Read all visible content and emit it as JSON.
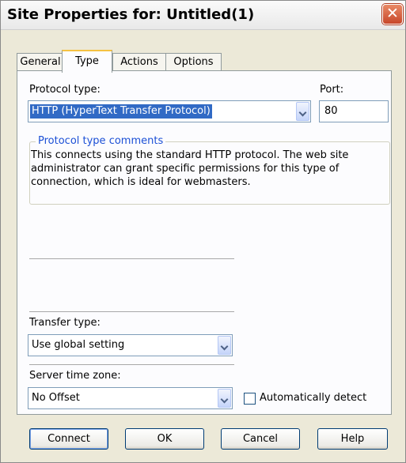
{
  "window": {
    "title": "Site Properties for: Untitled(1)",
    "close_glyph": "✕"
  },
  "tabs": [
    {
      "label": "General",
      "active": false
    },
    {
      "label": "Type",
      "active": true
    },
    {
      "label": "Actions",
      "active": false
    },
    {
      "label": "Options",
      "active": false
    }
  ],
  "protocol": {
    "label": "Protocol type:",
    "value": "HTTP (HyperText Transfer Protocol)"
  },
  "port": {
    "label": "Port:",
    "value": "80"
  },
  "comments": {
    "legend": "Protocol type comments",
    "text": "This connects using the standard HTTP protocol. The web site administrator can grant specific permissions for this type of connection, which is ideal for webmasters."
  },
  "transfer": {
    "label": "Transfer type:",
    "value": "Use global setting"
  },
  "timezone": {
    "label": "Server time zone:",
    "value": "No Offset",
    "auto_detect_label": "Automatically detect",
    "auto_detect_checked": false
  },
  "buttons": {
    "connect": "Connect",
    "ok": "OK",
    "cancel": "Cancel",
    "help": "Help"
  },
  "colors": {
    "tab_highlight": "#f5c242",
    "selection": "#316ac5",
    "legend_text": "#1c50d6",
    "close_button": "#c7472a"
  }
}
